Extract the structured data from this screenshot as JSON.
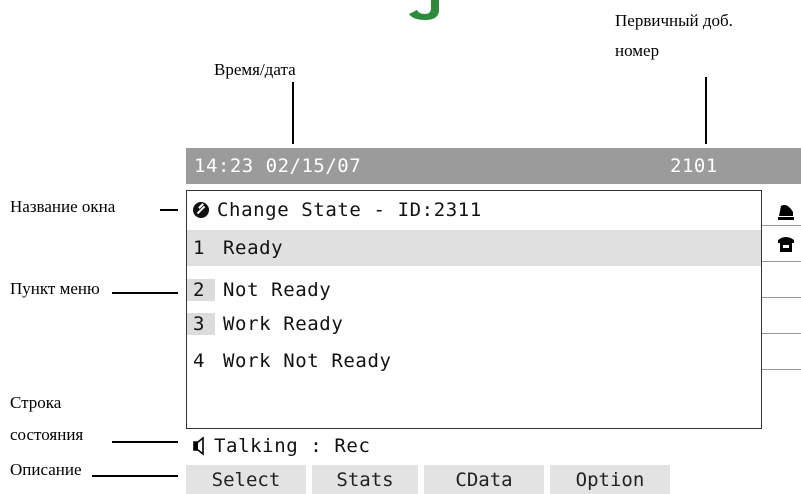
{
  "callouts": {
    "time_date": "Время/дата",
    "primary_ext_line1": "Первичный доб.",
    "primary_ext_line2": "номер",
    "window_title": "Название окна",
    "menu_item": "Пункт меню",
    "status_line_line1": "Строка",
    "status_line_line2": "состояния",
    "description": "Описание"
  },
  "status_bar": {
    "time_date": "14:23 02/15/07",
    "extension": "2101"
  },
  "window": {
    "title": "Change State - ID:2311",
    "items": [
      {
        "num": "1",
        "label": "Ready"
      },
      {
        "num": "2",
        "label": "Not Ready"
      },
      {
        "num": "3",
        "label": "Work Ready"
      },
      {
        "num": "4",
        "label": "Work Not Ready"
      }
    ]
  },
  "status_line": {
    "text": "Talking : Rec"
  },
  "softkeys": [
    "Select",
    "Stats",
    "CData",
    "Option"
  ],
  "colors": {
    "status_bar_bg": "#9b9b9b",
    "highlight_bg": "#e0e0e0",
    "softkey_bg": "#e3e3e3",
    "brand_green": "#2e8b3c"
  },
  "icons": {
    "title": "change-state-icon",
    "line1": "handset-off-hook-icon",
    "line2": "desk-phone-icon",
    "status": "speaker-icon"
  }
}
